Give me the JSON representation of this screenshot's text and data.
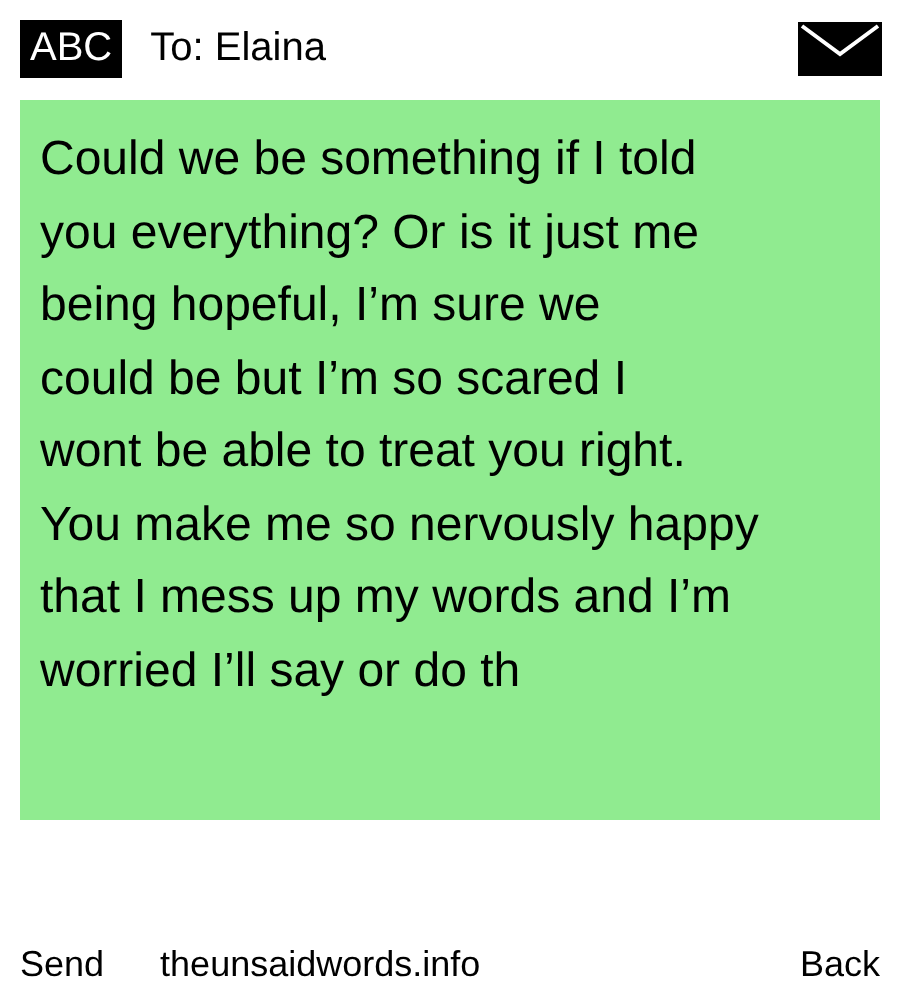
{
  "header": {
    "mode": "ABC",
    "recipient": "To: Elaina"
  },
  "message": {
    "lines": [
      "Could we be something if I told",
      "you everything? Or is it just me",
      "being hopeful, I’m sure we",
      "could be but I’m so scared I",
      "wont be able to treat you right.",
      "You make me so nervously happy",
      "that I mess up my words and I’m",
      "worried I’ll say or do th"
    ]
  },
  "footer": {
    "left": "Send",
    "center": "theunsaidwords.info",
    "right": "Back"
  }
}
